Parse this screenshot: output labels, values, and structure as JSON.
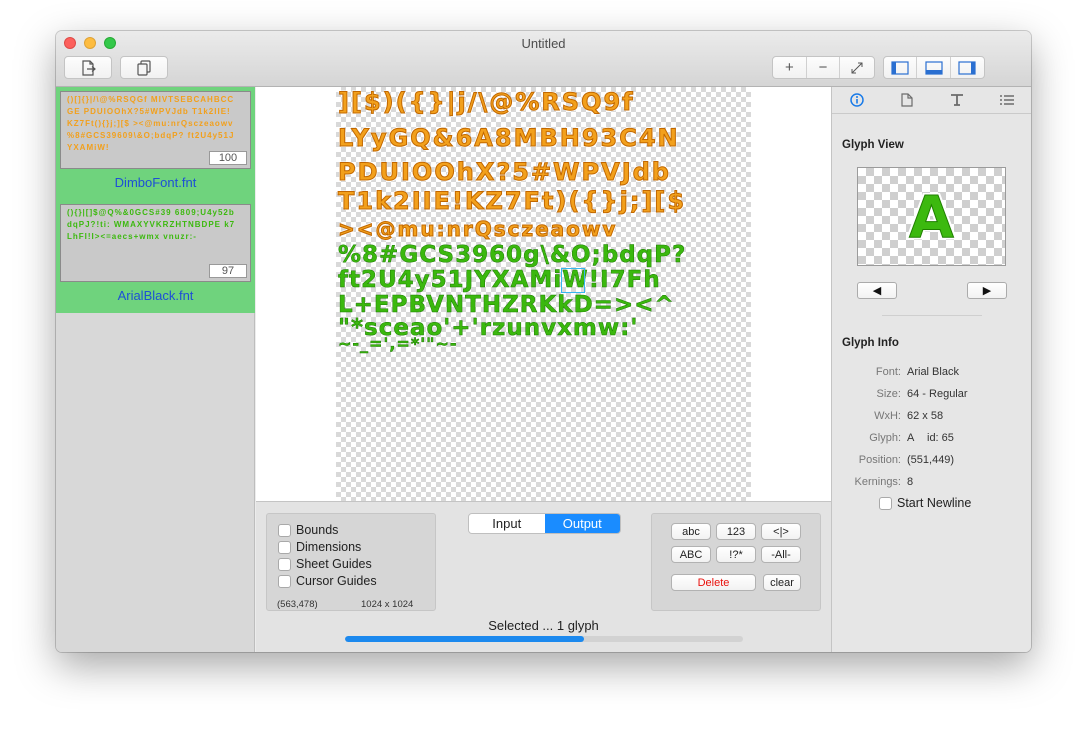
{
  "window": {
    "title": "Untitled"
  },
  "sidebar": {
    "fonts": [
      {
        "name": "DimboFont.fnt",
        "count": "100",
        "preview": "()[]{}|/\\@%RSQGf MIVTSEBCAHBCCGE PDUIOOhX?5#WPVJdb T1k2IIE!KZ7Ft(){}j;][$ ><@mu:nrQsczeaowv %8#GCS39609\\&O;bdqP? ft2U4y51JYXAMiW!"
      },
      {
        "name": "ArialBlack.fnt",
        "count": "97",
        "preview": "(){}|[]$@Q%&0GCS#39 6809;U4y52bdqPJ?!ti: WMAXYVKRZHTNBDPE k7LhFI!I><=aecs+wmx vnuzr:-"
      }
    ]
  },
  "canvas": {
    "orange_rows": [
      "][$)({}|j/\\@%RSQ9f",
      "LYyGQ&6A8MBH93C4N",
      "PDUIOOhX?5#WPVJdb",
      "T1k2IIE!KZ7Ft)({}j;][$",
      "><@mu:nrQsczeaowv"
    ],
    "green_rows": [
      "%8#GCS3960g\\&O;bdqP?",
      "ft2U4y51JYXAMiW!I7Fh",
      "L+EPBVNTHZRKkD=><^",
      "\"*sceao'+'rzunvxmw:'",
      "~-_=',=*'\"~-"
    ]
  },
  "options": {
    "checkboxes": [
      "Bounds",
      "Dimensions",
      "Sheet Guides",
      "Cursor Guides"
    ],
    "cursor_coord": "(563,478)",
    "sheet_size": "1024 x 1024"
  },
  "mode": {
    "input": "Input",
    "output": "Output",
    "selected": "Output"
  },
  "filters": {
    "lower": "abc",
    "digits": "123",
    "brackets": "<|>",
    "upper": "ABC",
    "symbols": "!?*",
    "all": "-All-",
    "delete": "Delete",
    "clear": "clear"
  },
  "status": {
    "text": "Selected ... 1 glyph",
    "progress": 0.6
  },
  "inspector": {
    "tabs": [
      "info-icon",
      "document-icon",
      "text-icon",
      "list-icon"
    ],
    "glyph_view_title": "Glyph View",
    "glyph": "A",
    "prev": "◀",
    "next": "▶",
    "glyph_info_title": "Glyph Info",
    "font_label": "Font:",
    "font": "Arial Black",
    "size_label": "Size:",
    "size": "64 - Regular",
    "wxh_label": "WxH:",
    "wxh": "62 x 58",
    "glyph_label": "Glyph:",
    "glyph_value": "A",
    "id_value": "id: 65",
    "position_label": "Position:",
    "position": "(551,449)",
    "kernings_label": "Kernings:",
    "kernings": "8",
    "start_newline": "Start Newline"
  },
  "colors": {
    "accent": "#1a8cff",
    "sidebar_selected": "#6fd37d",
    "delete_text": "#e8100c",
    "font_name_link": "#1d4fd6"
  }
}
